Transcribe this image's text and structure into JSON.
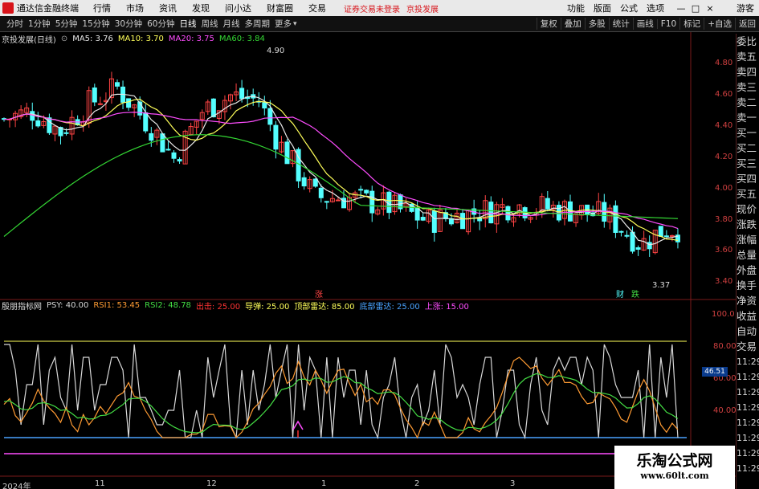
{
  "app": {
    "title": "通达信金融终端"
  },
  "menu": [
    "行情",
    "市场",
    "资讯",
    "发现",
    "问小达",
    "财富圈",
    "交易"
  ],
  "notice": "证券交易未登录",
  "stock_link": "京投发展",
  "top_right": [
    "功能",
    "版面",
    "公式",
    "选项"
  ],
  "window_buttons": [
    "—",
    "□",
    "×"
  ],
  "guest": "游客",
  "periods": [
    "分时",
    "1分钟",
    "5分钟",
    "15分钟",
    "30分钟",
    "60分钟",
    "日线",
    "周线",
    "月线",
    "多周期",
    "更多"
  ],
  "active_period": "日线",
  "toolbar_right": [
    "复权",
    "叠加",
    "多股",
    "统计",
    "画线",
    "F10",
    "标记",
    "+自选",
    "返回"
  ],
  "main_legend": {
    "stock": "京投发展(日线)",
    "ma5": "MA5: 3.76",
    "ma10": "MA10: 3.70",
    "ma20": "MA20: 3.75",
    "ma60": "MA60: 3.84"
  },
  "price_axis": [
    "4.80",
    "4.60",
    "4.40",
    "4.20",
    "4.00",
    "3.80",
    "3.60",
    "3.40"
  ],
  "annotations": {
    "high": "4.90",
    "low": "3.37",
    "zhang": "涨",
    "cai": "财",
    "die": "跌"
  },
  "ind_legend": {
    "name": "殷朋指标网",
    "psy": "PSY: 40.00",
    "rsi1": "RSI1: 53.45",
    "rsi2": "RSI2: 48.78",
    "chuji": "出击: 25.00",
    "daodan": "导弹: 25.00",
    "top": "顶部雷达: 85.00",
    "bottom": "底部雷达: 25.00",
    "up": "上涨: 15.00"
  },
  "ind_axis": [
    "100.0",
    "80.00",
    "60.00",
    "40.00"
  ],
  "ind_value_box": "46.51",
  "x_axis": [
    "2024年",
    "11",
    "12",
    "1",
    "2",
    "3"
  ],
  "right_panel_top": [
    "委比",
    "卖五",
    "卖四",
    "卖三",
    "卖二",
    "卖一",
    "买一",
    "买二",
    "买三",
    "买四",
    "买五",
    "现价",
    "涨跌",
    "涨幅",
    "总量",
    "外盘",
    "换手",
    "净资",
    "收益"
  ],
  "right_panel_bottom": [
    "自动",
    "交易",
    "11:29",
    "11:29",
    "11:29",
    "11:29",
    "11:29",
    "11:29",
    "11:29",
    "11:29",
    "11:29",
    "11:29"
  ],
  "watermark": {
    "title": "乐淘公式网",
    "url": "www.60lt.com"
  },
  "colors": {
    "up": "#ff4444",
    "down": "#54ffff",
    "ma5": "#e8e8e8",
    "ma10": "#ffff5a",
    "ma20": "#ff4dff",
    "ma60": "#34d834",
    "psy": "#d8d8d8",
    "rsi1": "#ff9b33",
    "rsi2": "#44dd44"
  }
}
